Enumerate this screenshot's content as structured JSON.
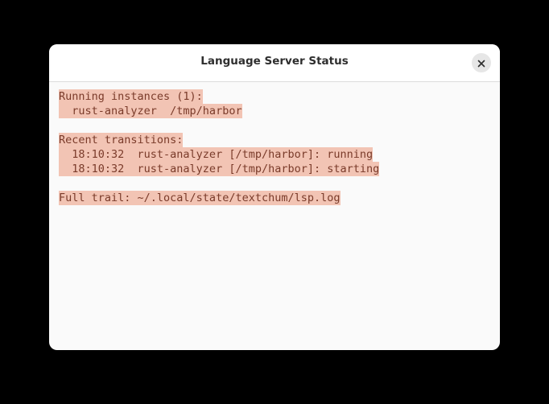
{
  "dialog": {
    "title": "Language Server Status",
    "close_icon": "close-icon"
  },
  "content": {
    "lines": [
      "Running instances (1):",
      "  rust-analyzer  /tmp/harbor",
      "",
      "Recent transitions:",
      "  18:10:32  rust-analyzer [/tmp/harbor]: running",
      "  18:10:32  rust-analyzer [/tmp/harbor]: starting",
      "",
      "Full trail: ~/.local/state/textchum/lsp.log"
    ]
  },
  "colors": {
    "highlight_bg": "#f2c4b4",
    "highlight_text": "#7a3b2a",
    "dialog_bg": "#fafafa",
    "backdrop": "#000000"
  }
}
